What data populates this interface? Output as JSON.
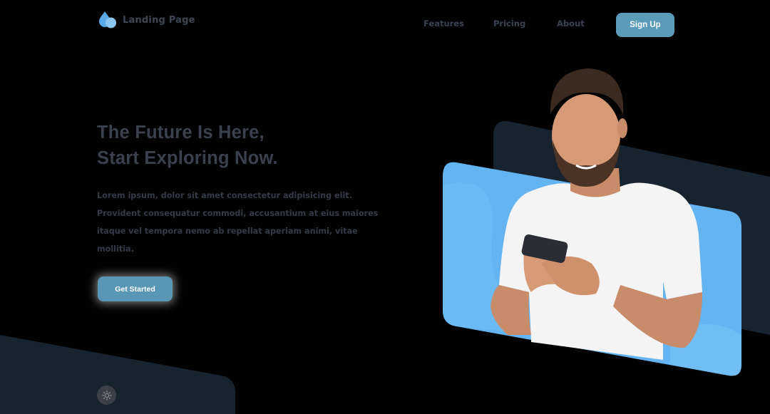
{
  "header": {
    "logo_text": "Landing Page",
    "nav": [
      {
        "label": "Features"
      },
      {
        "label": "Pricing"
      },
      {
        "label": "About"
      }
    ],
    "signup_label": "Sign Up"
  },
  "hero": {
    "title_line1": "The Future Is Here,",
    "title_line2": "Start Exploring Now.",
    "description": "Lorem ipsum, dolor sit amet consectetur adipisicing elit. Provident consequatur commodi, accusantium at eius maiores itaque vel tempora nemo ab repellat aperiam animi, vitae mollitia.",
    "cta_label": "Get Started"
  },
  "icons": {
    "logo": "water-drop-icon",
    "theme_toggle": "sun-icon"
  },
  "colors": {
    "background": "#020203",
    "accent": "#5b9bb8",
    "card": "#63b4f1",
    "dark_panel": "#17232e"
  }
}
